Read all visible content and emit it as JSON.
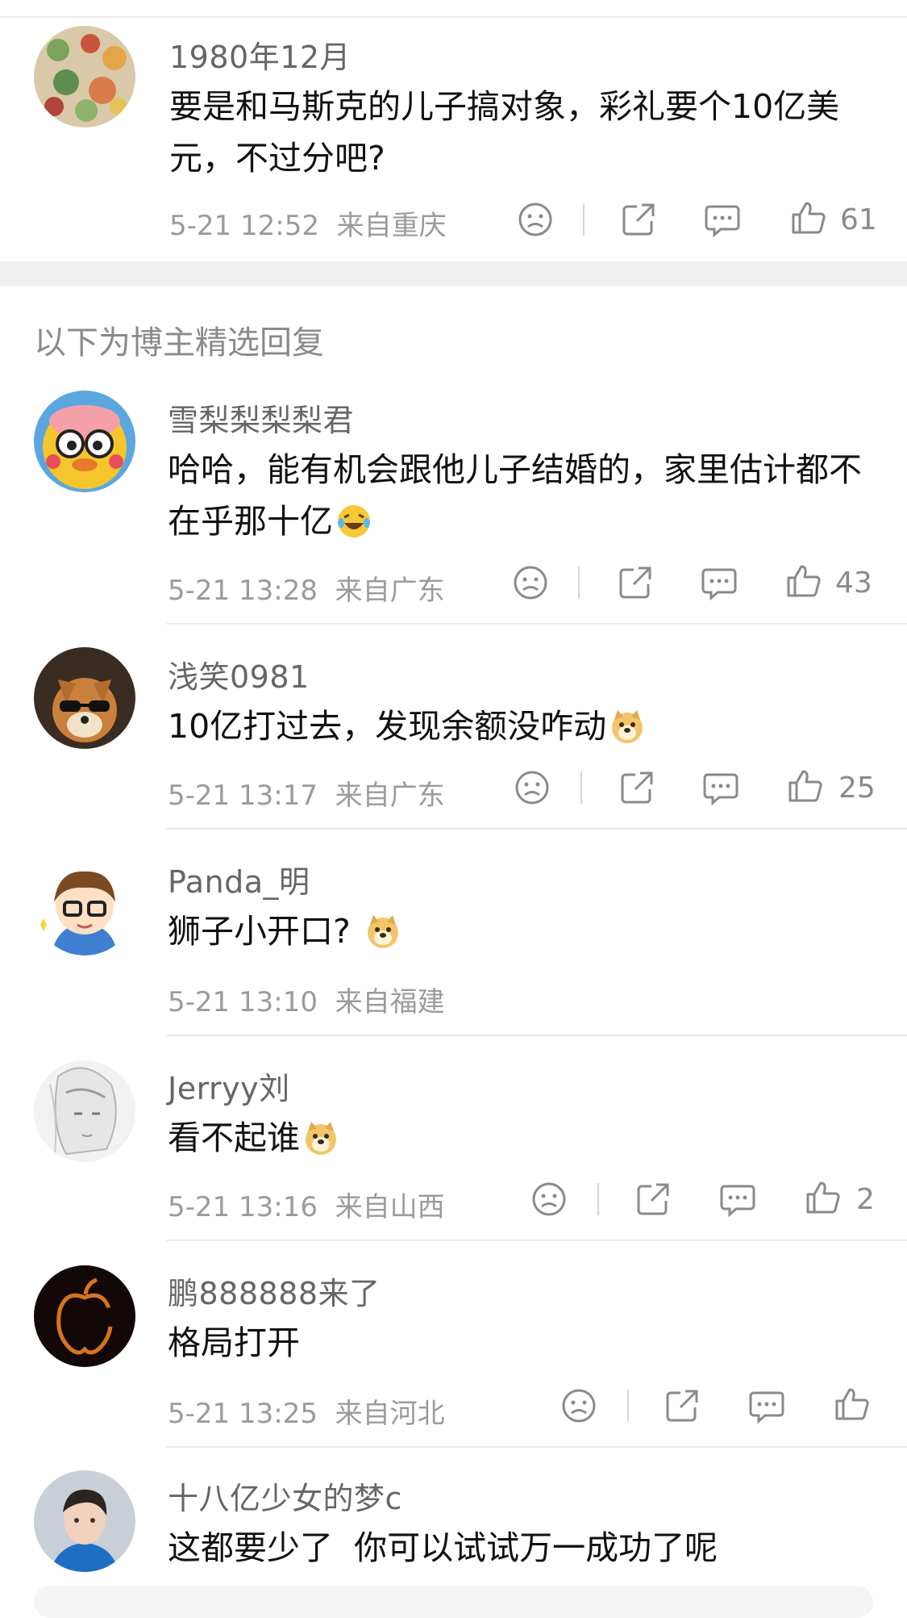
{
  "top_comment": {
    "username": "1980年12月",
    "text_line1": "要是和马斯克的儿子搞对象，彩礼要个10亿美",
    "text_line2": "元，不过分吧?",
    "time": "5-21 12:52",
    "location": "来自重庆",
    "like_count": "61"
  },
  "section_title": "以下为博主精选回复",
  "replies": [
    {
      "username": "雪梨梨梨梨君",
      "text_line1": "哈哈，能有机会跟他儿子结婚的，家里估计都不",
      "text_line2": "在乎那十亿",
      "emoji": "laugh-cry-emoji",
      "time": "5-21 13:28",
      "location": "来自广东",
      "like_count": "43"
    },
    {
      "username": "浅笑0981",
      "text_line1": "10亿打过去，发现余额没咋动",
      "emoji": "doge-emoji",
      "time": "5-21 13:17",
      "location": "来自广东",
      "like_count": "25"
    },
    {
      "username": "Panda_明",
      "text_line1": "狮子小开口?",
      "emoji": "doge-emoji",
      "time": "5-21 13:10",
      "location": "来自福建"
    },
    {
      "username": "Jerryy刘",
      "text_line1": "看不起谁",
      "emoji": "doge-emoji",
      "time": "5-21 13:16",
      "location": "来自山西",
      "like_count": "2"
    },
    {
      "username": "鹏888888来了",
      "text_line1": "格局打开",
      "time": "5-21 13:25",
      "location": "来自河北"
    },
    {
      "username": "十八亿少女的梦c",
      "text_line1": "这都要少了  你可以试试万一成功了呢"
    }
  ],
  "icons": {
    "dislike": "frown-icon",
    "share": "share-icon",
    "comment": "comment-icon",
    "like": "thumbs-up-icon"
  }
}
